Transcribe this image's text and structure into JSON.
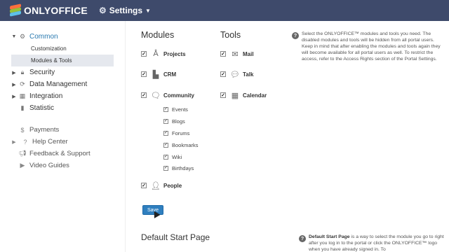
{
  "header": {
    "logo_text": "ONLYOFFICE",
    "settings_label": "Settings"
  },
  "sidebar": {
    "common": {
      "label": "Common",
      "children": [
        "Customization",
        "Modules & Tools"
      ]
    },
    "groups": [
      {
        "label": "Security",
        "icon": "lock-icon"
      },
      {
        "label": "Data Management",
        "icon": "refresh-icon"
      },
      {
        "label": "Integration",
        "icon": "grid-icon"
      },
      {
        "label": "Statistic",
        "icon": "bar-chart-icon"
      }
    ],
    "links": [
      {
        "label": "Payments",
        "icon": "dollar-icon"
      },
      {
        "label": "Help Center",
        "icon": "question-icon"
      },
      {
        "label": "Feedback & Support",
        "icon": "megaphone-icon"
      },
      {
        "label": "Video Guides",
        "icon": "video-icon"
      }
    ]
  },
  "main": {
    "modules_title": "Modules",
    "tools_title": "Tools",
    "modules": [
      {
        "label": "Projects",
        "icon": "projects-icon",
        "checked": true
      },
      {
        "label": "CRM",
        "icon": "crm-icon",
        "checked": true
      },
      {
        "label": "Community",
        "icon": "community-icon",
        "checked": true
      },
      {
        "label": "People",
        "icon": "people-icon",
        "checked": true
      }
    ],
    "community_items": [
      "Events",
      "Blogs",
      "Forums",
      "Bookmarks",
      "Wiki",
      "Birthdays"
    ],
    "tools": [
      {
        "label": "Mail",
        "icon": "mail-icon",
        "checked": true
      },
      {
        "label": "Talk",
        "icon": "talk-icon",
        "checked": true
      },
      {
        "label": "Calendar",
        "icon": "calendar-icon",
        "checked": true
      }
    ],
    "save_label": "Save",
    "help_text": "Select the ONLYOFFICE™ modules and tools you need. The disabled modules and tools will be hidden from all portal users. Keep in mind that after enabling the modules and tools again they will become available for all portal users as well. To restrict the access, refer to the Access Rights section of the Portal Settings.",
    "default_start_title": "Default Start Page",
    "default_start_help_bold": "Default Start Page",
    "default_start_help_rest": " is a way to select the module you go to right after you log in to the portal or click the ONLYOFFICE™ logo when you have already signed in. To"
  },
  "colors": {
    "header_bg": "#3e4a6b",
    "accent": "#2a7ab0",
    "button": "#2f7fbf",
    "selected_bg": "#e5e8ee"
  }
}
